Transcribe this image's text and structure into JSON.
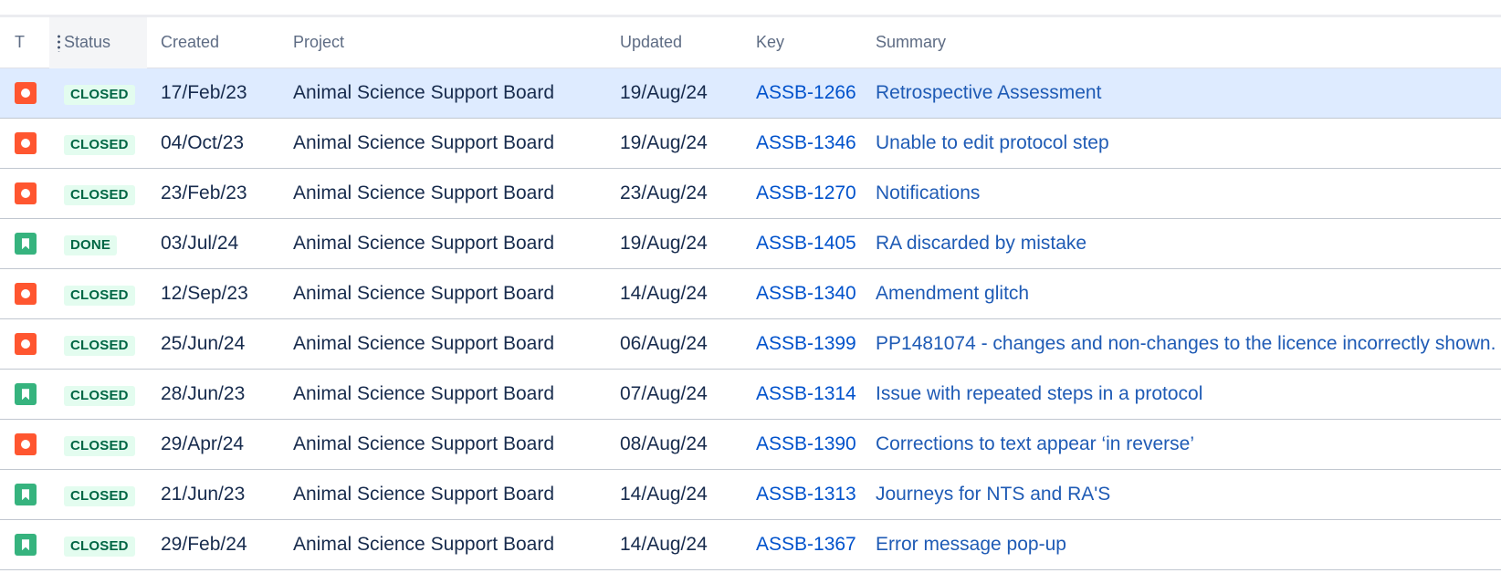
{
  "columns": {
    "type": "T",
    "status": "Status",
    "created": "Created",
    "project": "Project",
    "updated": "Updated",
    "key": "Key",
    "summary": "Summary"
  },
  "rows": [
    {
      "type_icon": "bug-icon",
      "status": "CLOSED",
      "created": "17/Feb/23",
      "project": "Animal Science Support Board",
      "updated": "19/Aug/24",
      "key": "ASSB-1266",
      "summary": "Retrospective Assessment",
      "selected": true
    },
    {
      "type_icon": "bug-icon",
      "status": "CLOSED",
      "created": "04/Oct/23",
      "project": "Animal Science Support Board",
      "updated": "19/Aug/24",
      "key": "ASSB-1346",
      "summary": "Unable to edit protocol step"
    },
    {
      "type_icon": "bug-icon",
      "status": "CLOSED",
      "created": "23/Feb/23",
      "project": "Animal Science Support Board",
      "updated": "23/Aug/24",
      "key": "ASSB-1270",
      "summary": "Notifications"
    },
    {
      "type_icon": "story-icon",
      "status": "DONE",
      "created": "03/Jul/24",
      "project": "Animal Science Support Board",
      "updated": "19/Aug/24",
      "key": "ASSB-1405",
      "summary": "RA discarded by mistake"
    },
    {
      "type_icon": "bug-icon",
      "status": "CLOSED",
      "created": "12/Sep/23",
      "project": "Animal Science Support Board",
      "updated": "14/Aug/24",
      "key": "ASSB-1340",
      "summary": "Amendment glitch"
    },
    {
      "type_icon": "bug-icon",
      "status": "CLOSED",
      "created": "25/Jun/24",
      "project": "Animal Science Support Board",
      "updated": "06/Aug/24",
      "key": "ASSB-1399",
      "summary": "PP1481074 - changes and non-changes to the licence incorrectly shown."
    },
    {
      "type_icon": "story-icon",
      "status": "CLOSED",
      "created": "28/Jun/23",
      "project": "Animal Science Support Board",
      "updated": "07/Aug/24",
      "key": "ASSB-1314",
      "summary": "Issue with repeated steps in a protocol"
    },
    {
      "type_icon": "bug-icon",
      "status": "CLOSED",
      "created": "29/Apr/24",
      "project": "Animal Science Support Board",
      "updated": "08/Aug/24",
      "key": "ASSB-1390",
      "summary": "Corrections to text appear ‘in reverse’"
    },
    {
      "type_icon": "story-icon",
      "status": "CLOSED",
      "created": "21/Jun/23",
      "project": "Animal Science Support Board",
      "updated": "14/Aug/24",
      "key": "ASSB-1313",
      "summary": "Journeys for NTS and RA'S"
    },
    {
      "type_icon": "story-icon",
      "status": "CLOSED",
      "created": "29/Feb/24",
      "project": "Animal Science Support Board",
      "updated": "14/Aug/24",
      "key": "ASSB-1367",
      "summary": "Error message pop-up"
    }
  ],
  "colors": {
    "bug": "#ff5630",
    "story": "#36b37e",
    "status_badge_bg": "#e3fcef",
    "status_badge_text": "#006644",
    "link": "#0052cc",
    "selected_row": "#deebff"
  }
}
